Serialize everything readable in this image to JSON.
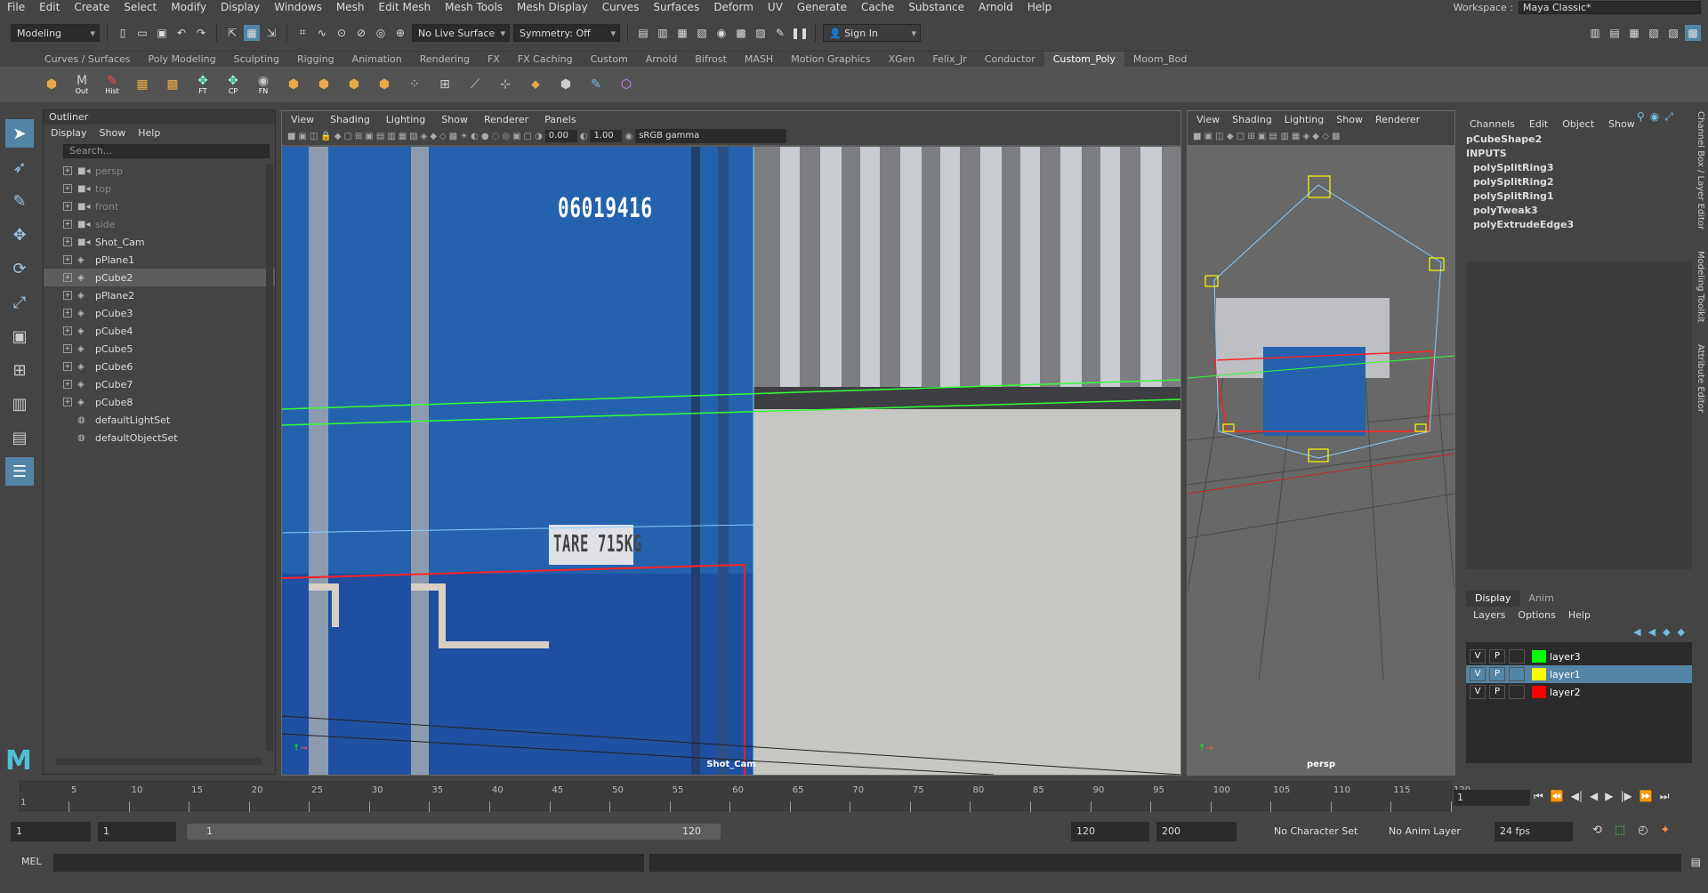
{
  "menubar": {
    "items": [
      "File",
      "Edit",
      "Create",
      "Select",
      "Modify",
      "Display",
      "Windows",
      "Mesh",
      "Edit Mesh",
      "Mesh Tools",
      "Mesh Display",
      "Curves",
      "Surfaces",
      "Deform",
      "UV",
      "Generate",
      "Cache",
      "Substance",
      "Arnold",
      "Help"
    ],
    "workspace_label": "Workspace :",
    "workspace_value": "Maya Classic*"
  },
  "statusline": {
    "mode": "Modeling",
    "live_surface": "No Live Surface",
    "symmetry": "Symmetry: Off",
    "sign_in": "Sign In"
  },
  "shelf": {
    "tabs": [
      "Curves / Surfaces",
      "Poly Modeling",
      "Sculpting",
      "Rigging",
      "Animation",
      "Rendering",
      "FX",
      "FX Caching",
      "Custom",
      "Arnold",
      "Bifrost",
      "MASH",
      "Motion Graphics",
      "XGen",
      "Felix_Jr",
      "Conductor",
      "Custom_Poly",
      "Moom_Bod"
    ],
    "active_tab": "Custom_Poly",
    "icon_labels": [
      "",
      "Out",
      "Hist",
      "",
      "",
      "FT",
      "CP",
      "FN"
    ]
  },
  "outliner": {
    "title": "Outliner",
    "menu": [
      "Display",
      "Show",
      "Help"
    ],
    "search_placeholder": "Search...",
    "items": [
      {
        "label": "persp",
        "type": "camera",
        "dim": true
      },
      {
        "label": "top",
        "type": "camera",
        "dim": true
      },
      {
        "label": "front",
        "type": "camera",
        "dim": true
      },
      {
        "label": "side",
        "type": "camera",
        "dim": true
      },
      {
        "label": "Shot_Cam",
        "type": "camera",
        "dim": false
      },
      {
        "label": "pPlane1",
        "type": "mesh",
        "dim": false
      },
      {
        "label": "pCube2",
        "type": "mesh",
        "dim": false,
        "selected": true
      },
      {
        "label": "pPlane2",
        "type": "mesh",
        "dim": false
      },
      {
        "label": "pCube3",
        "type": "mesh",
        "dim": false
      },
      {
        "label": "pCube4",
        "type": "mesh",
        "dim": false
      },
      {
        "label": "pCube5",
        "type": "mesh",
        "dim": false
      },
      {
        "label": "pCube6",
        "type": "mesh",
        "dim": false
      },
      {
        "label": "pCube7",
        "type": "mesh",
        "dim": false
      },
      {
        "label": "pCube8",
        "type": "mesh",
        "dim": false
      },
      {
        "label": "defaultLightSet",
        "type": "set",
        "dim": false
      },
      {
        "label": "defaultObjectSet",
        "type": "set",
        "dim": false
      }
    ]
  },
  "viewport_main": {
    "menu": [
      "View",
      "Shading",
      "Lighting",
      "Show",
      "Renderer",
      "Panels"
    ],
    "val_a": "0.00",
    "val_b": "1.00",
    "colorspace": "sRGB gamma",
    "camera_label": "Shot_Cam",
    "id_text": "06019416",
    "tare_text": "TARE 715KG"
  },
  "viewport_persp": {
    "menu": [
      "View",
      "Shading",
      "Lighting",
      "Show",
      "Renderer"
    ],
    "camera_label": "persp"
  },
  "channelbox": {
    "menu": [
      "Channels",
      "Edit",
      "Object",
      "Show"
    ],
    "object": "pCubeShape2",
    "inputs_label": "INPUTS",
    "inputs": [
      "polySplitRing3",
      "polySplitRing2",
      "polySplitRing1",
      "polyTweak3",
      "polyExtrudeEdge3"
    ],
    "side_tabs": [
      "Channel Box / Layer Editor",
      "Modeling Toolkit",
      "Attribute Editor"
    ]
  },
  "layers": {
    "tabs": [
      "Display",
      "Anim"
    ],
    "menu": [
      "Layers",
      "Options",
      "Help"
    ],
    "rows": [
      {
        "v": "V",
        "p": "P",
        "name": "layer3",
        "color": "#00ff00"
      },
      {
        "v": "V",
        "p": "P",
        "name": "layer1",
        "color": "#ffff00",
        "selected": true
      },
      {
        "v": "V",
        "p": "P",
        "name": "layer2",
        "color": "#ff0000"
      }
    ]
  },
  "timeslider": {
    "ticks": [
      "5",
      "10",
      "15",
      "20",
      "25",
      "30",
      "35",
      "40",
      "45",
      "50",
      "55",
      "60",
      "65",
      "70",
      "75",
      "80",
      "85",
      "90",
      "95",
      "100",
      "105",
      "110",
      "115",
      "120"
    ],
    "current_frame": "1",
    "start_marker": "1"
  },
  "range": {
    "start": "1",
    "playback_start": "1",
    "bar_start": "1",
    "bar_end": "120",
    "playback_end": "120",
    "end": "200",
    "character_set": "No Character Set",
    "anim_layer": "No Anim Layer",
    "fps": "24 fps"
  },
  "cmdline": {
    "label": "MEL"
  }
}
